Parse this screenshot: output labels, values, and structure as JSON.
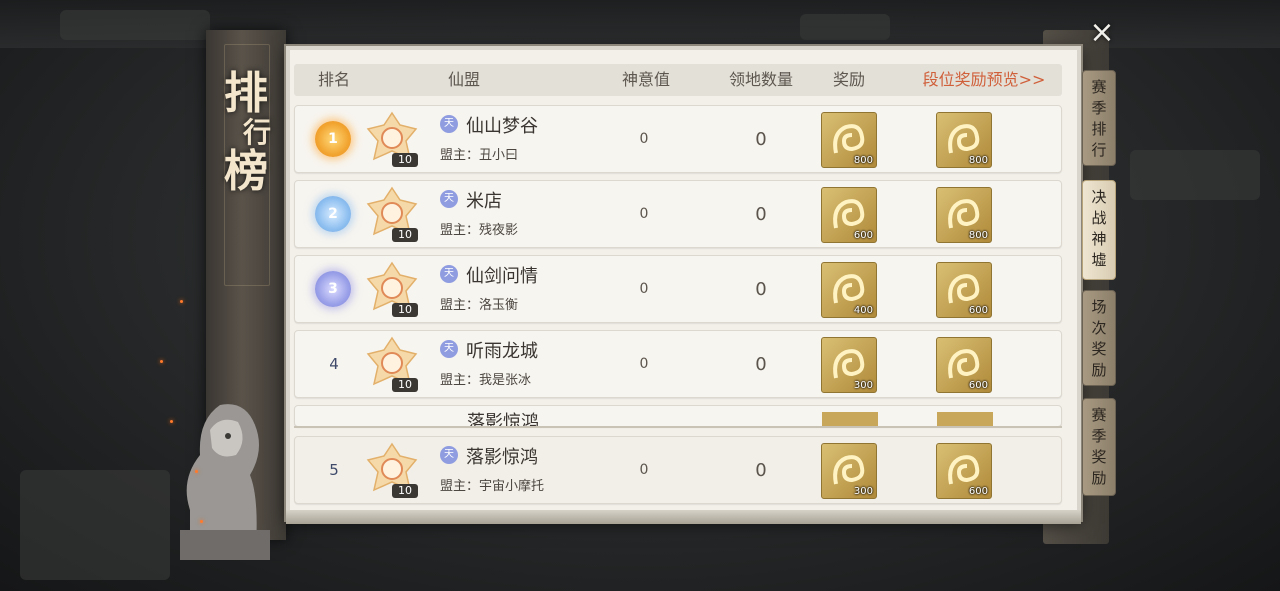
{
  "banner": {
    "title_1": "排",
    "title_2": "行",
    "title_3": "榜"
  },
  "headers": {
    "rank": "排名",
    "guild": "仙盟",
    "shenyi": "神意值",
    "territory": "领地数量",
    "reward": "奖励",
    "preview_link": "段位奖励预览>>"
  },
  "rows": [
    {
      "rank": "1",
      "medal": "gold",
      "level": "10",
      "guild_icon": "天",
      "name": "仙山梦谷",
      "leader": "盟主：丑小曰",
      "shenyi": "0",
      "territory": "0",
      "reward1_count": "800",
      "reward2_count": "800"
    },
    {
      "rank": "2",
      "medal": "silver",
      "level": "10",
      "guild_icon": "天",
      "name": "米店",
      "leader": "盟主：残夜影",
      "shenyi": "0",
      "territory": "0",
      "reward1_count": "600",
      "reward2_count": "800"
    },
    {
      "rank": "3",
      "medal": "bronze",
      "level": "10",
      "guild_icon": "天",
      "name": "仙剑问情",
      "leader": "盟主：洛玉衡",
      "shenyi": "0",
      "territory": "0",
      "reward1_count": "400",
      "reward2_count": "600"
    },
    {
      "rank": "4",
      "medal": "none",
      "level": "10",
      "guild_icon": "天",
      "name": "听雨龙城",
      "leader": "盟主：我是张冰",
      "shenyi": "0",
      "territory": "0",
      "reward1_count": "300",
      "reward2_count": "600"
    },
    {
      "rank": "5",
      "name_partial": "落影惊鸿"
    }
  ],
  "my_row": {
    "rank": "5",
    "level": "10",
    "guild_icon": "天",
    "name": "落影惊鸿",
    "leader": "盟主：宇宙小摩托",
    "shenyi": "0",
    "territory": "0",
    "reward1_count": "300",
    "reward2_count": "600"
  },
  "tabs": [
    {
      "label": "赛季排行",
      "active": false
    },
    {
      "label": "决战神墟",
      "active": true
    },
    {
      "label": "场次奖励",
      "active": false
    },
    {
      "label": "赛季奖励",
      "active": false
    }
  ],
  "close_glyph": "×",
  "colors": {
    "accent_orange": "#d0603a",
    "panel_bg": "#f3f0ea",
    "gold": "#f2a531"
  },
  "icons": {
    "reward": "golden-dragon-token-icon",
    "emblem": "guild-emblem-icon",
    "close": "close-icon"
  }
}
